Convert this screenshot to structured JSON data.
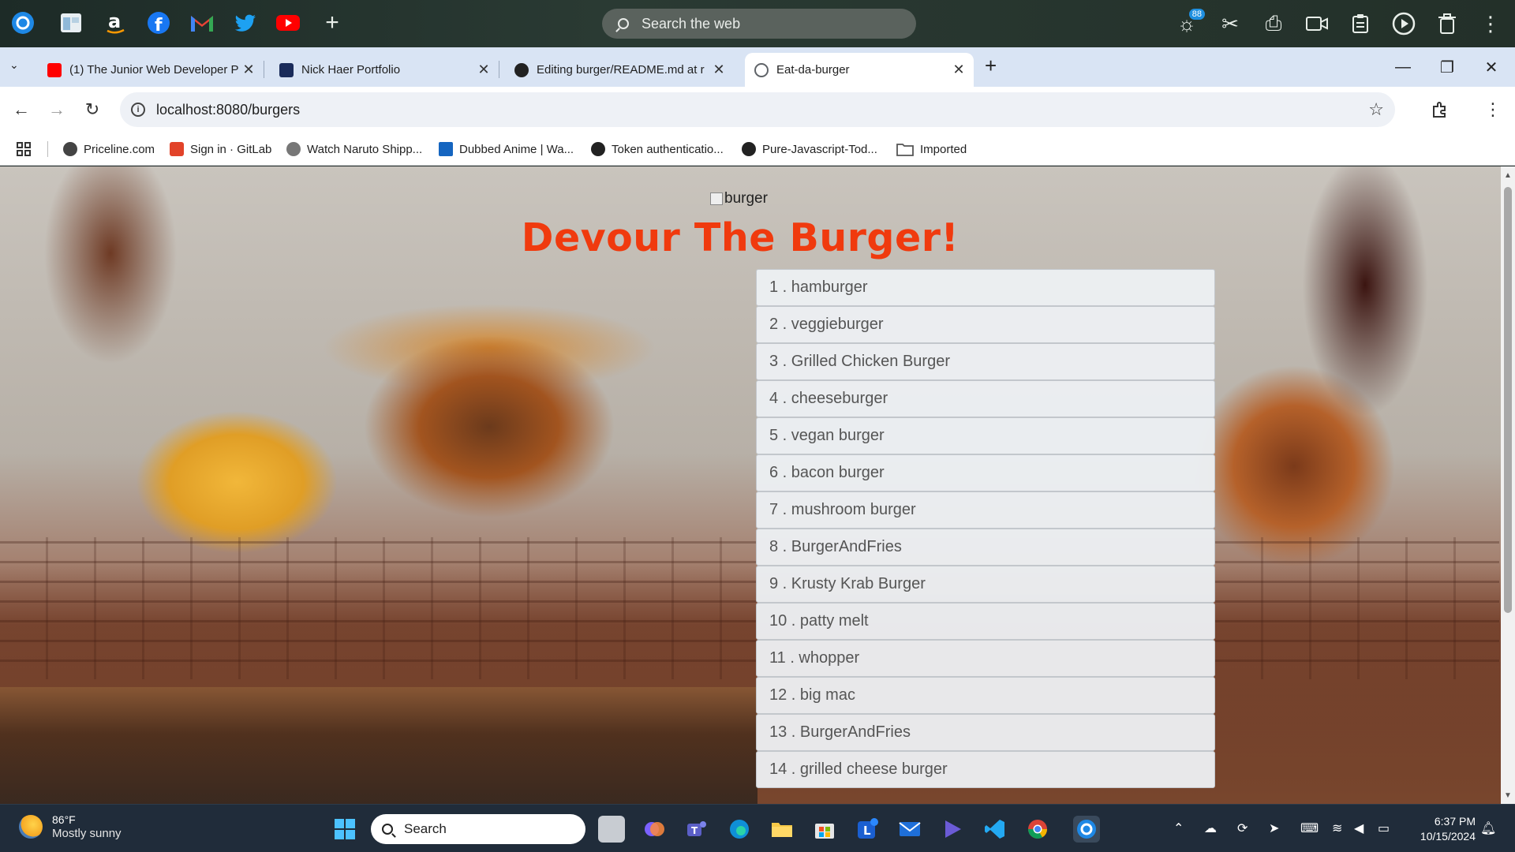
{
  "appbar": {
    "search_placeholder": "Search the web",
    "badge_count": "88",
    "left_icons": [
      "app-launcher-icon",
      "notes-icon",
      "amazon-icon",
      "facebook-icon",
      "gmail-icon",
      "twitter-icon",
      "youtube-icon",
      "add-icon"
    ],
    "right_icons": [
      "brightness-icon",
      "scissors-icon",
      "printer-icon",
      "camera-icon",
      "clipboard-icon",
      "play-icon",
      "trash-icon",
      "more-icon"
    ]
  },
  "tabs": [
    {
      "title": "(1) The Junior Web Developer P",
      "icon": "youtube-icon",
      "color": "#ff0000"
    },
    {
      "title": "Nick Haer Portfolio",
      "icon": "notion-icon",
      "color": "#1a2b5a"
    },
    {
      "title": "Editing burger/README.md at r",
      "icon": "github-icon",
      "color": "#222222"
    },
    {
      "title": "Eat-da-burger",
      "icon": "globe-icon",
      "color": "#5f6368",
      "active": true
    }
  ],
  "address": {
    "url": "localhost:8080/burgers"
  },
  "bookmarks": [
    {
      "label": "Priceline.com",
      "color": "#444444"
    },
    {
      "label": "Sign in · GitLab",
      "color": "#e24329"
    },
    {
      "label": "Watch Naruto Shipp...",
      "color": "#777777"
    },
    {
      "label": "Dubbed Anime | Wa...",
      "color": "#1565c0"
    },
    {
      "label": "Token authenticatio...",
      "color": "#222222"
    },
    {
      "label": "Pure-Javascript-Tod...",
      "color": "#222222"
    },
    {
      "label": "Imported",
      "color": "#555555"
    }
  ],
  "page": {
    "image_alt": "burger",
    "title": "Devour The Burger!",
    "title_color": "#f03a0e",
    "burgers": [
      "1 . hamburger",
      "2 . veggieburger",
      "3 . Grilled Chicken Burger",
      "4 . cheeseburger",
      "5 . vegan burger",
      "6 . bacon burger",
      "7 . mushroom burger",
      "8 . BurgerAndFries",
      "9 . Krusty Krab Burger",
      "10 . patty melt",
      "11 . whopper",
      "12 . big mac",
      "13 . BurgerAndFries",
      "14 . grilled cheese burger"
    ]
  },
  "taskbar": {
    "weather_temp": "86°F",
    "weather_desc": "Mostly sunny",
    "search_label": "Search",
    "time": "6:37 PM",
    "date": "10/15/2024"
  }
}
